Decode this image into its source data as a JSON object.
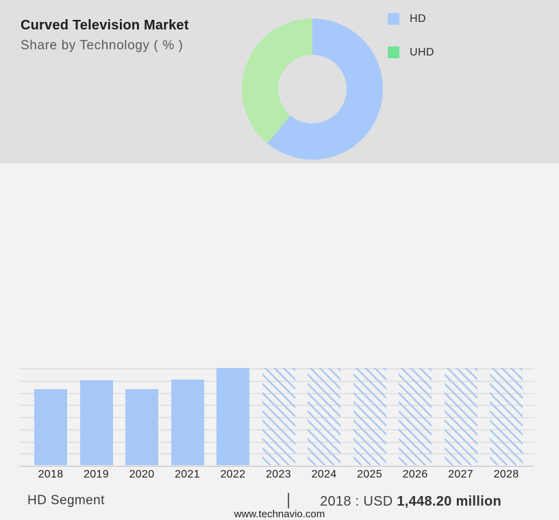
{
  "header": {
    "title": "Curved Television Market",
    "subtitle": "Share by Technology ( % )"
  },
  "legend": {
    "items": [
      {
        "label": "HD",
        "color": "#a6c8fa"
      },
      {
        "label": "UHD",
        "color": "#70e394"
      }
    ]
  },
  "chart_data": [
    {
      "type": "pie",
      "subtype": "donut",
      "title": "Share by Technology ( % )",
      "labels": [
        "HD",
        "UHD"
      ],
      "values_pct": [
        61,
        39
      ],
      "colors": [
        "#a6c8fb",
        "#b6ebac"
      ],
      "hole_ratio": 0.49,
      "legend_position": "right",
      "start_angle": "12 o'clock, clockwise"
    },
    {
      "type": "bar",
      "categories": [
        "2018",
        "2019",
        "2020",
        "2021",
        "2022",
        "2023",
        "2024",
        "2025",
        "2026",
        "2027",
        "2028"
      ],
      "values_pct_of_max": [
        78,
        87,
        78,
        88,
        100,
        100,
        100,
        100,
        100,
        100,
        100
      ],
      "bar_styles": [
        "solid",
        "solid",
        "solid",
        "solid",
        "solid",
        "hatched",
        "hatched",
        "hatched",
        "hatched",
        "hatched",
        "hatched"
      ],
      "solid_color": "#a6c7f8",
      "hatch_color": "#aac8f1",
      "grid": true,
      "gridline_count": 9,
      "y_axis_labels_visible": false
    }
  ],
  "caption": {
    "segment_label": "HD Segment",
    "separator": "|",
    "value_prefix": "2018 : USD",
    "value_bold": "1,448.20 million"
  },
  "footer": {
    "website": "www.technavio.com"
  }
}
